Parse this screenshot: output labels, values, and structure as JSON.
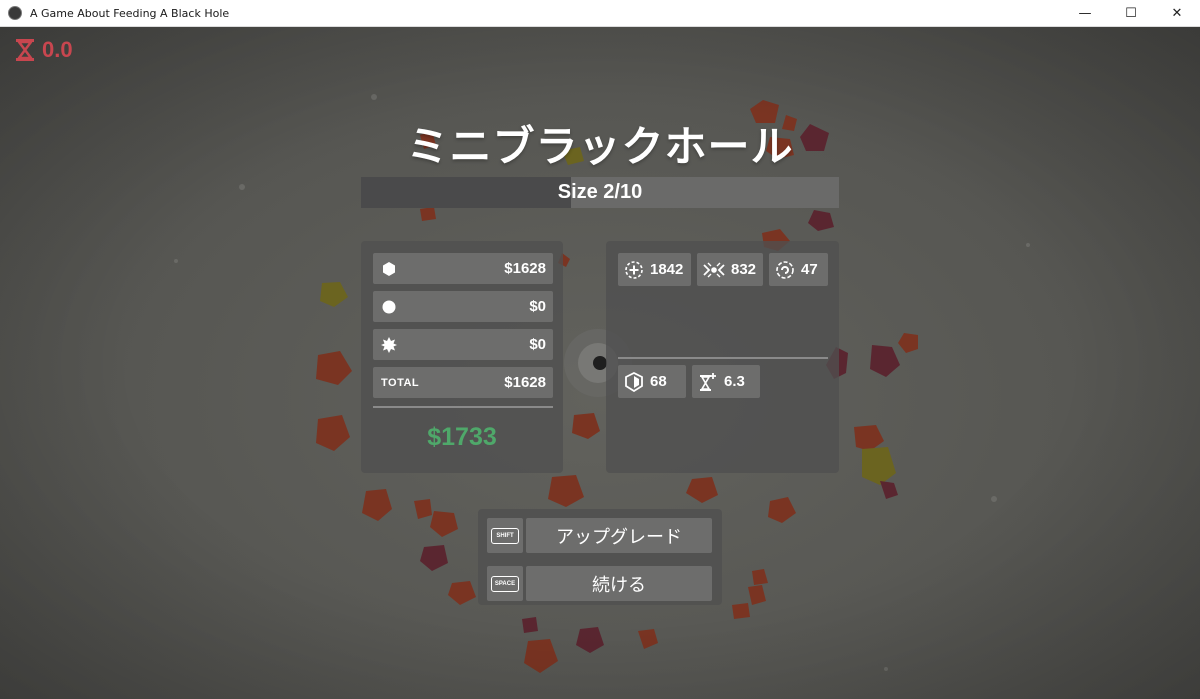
{
  "window": {
    "title": "A Game About Feeding A Black Hole",
    "controls": {
      "minimize": "—",
      "maximize": "☐",
      "close": "✕"
    }
  },
  "hud": {
    "timer": "0.0",
    "timer_color": "#c8464f"
  },
  "screen": {
    "title": "ミニブラックホール",
    "size_label": "Size 2/10",
    "size_progress": 0.44
  },
  "money": {
    "rows": [
      {
        "icon": "hexagon-icon",
        "value": "$1628"
      },
      {
        "icon": "circle-icon",
        "value": "$0"
      },
      {
        "icon": "burst-icon",
        "value": "$0"
      }
    ],
    "total_label": "TOTAL",
    "total_value": "$1628",
    "grand_total": "$1733",
    "grand_color": "#4fa86a"
  },
  "stats": {
    "top": [
      {
        "icon": "crosshair-plus-icon",
        "value": "1842"
      },
      {
        "icon": "attract-icon",
        "value": "832"
      },
      {
        "icon": "spiral-icon",
        "value": "47"
      }
    ],
    "bottom": [
      {
        "icon": "shield-icon",
        "value": "68"
      },
      {
        "icon": "hourglass-plus-icon",
        "value": "6.3"
      }
    ]
  },
  "actions": [
    {
      "key": "SHIFT",
      "label": "アップグレード"
    },
    {
      "key": "SPACE",
      "label": "続ける"
    }
  ]
}
